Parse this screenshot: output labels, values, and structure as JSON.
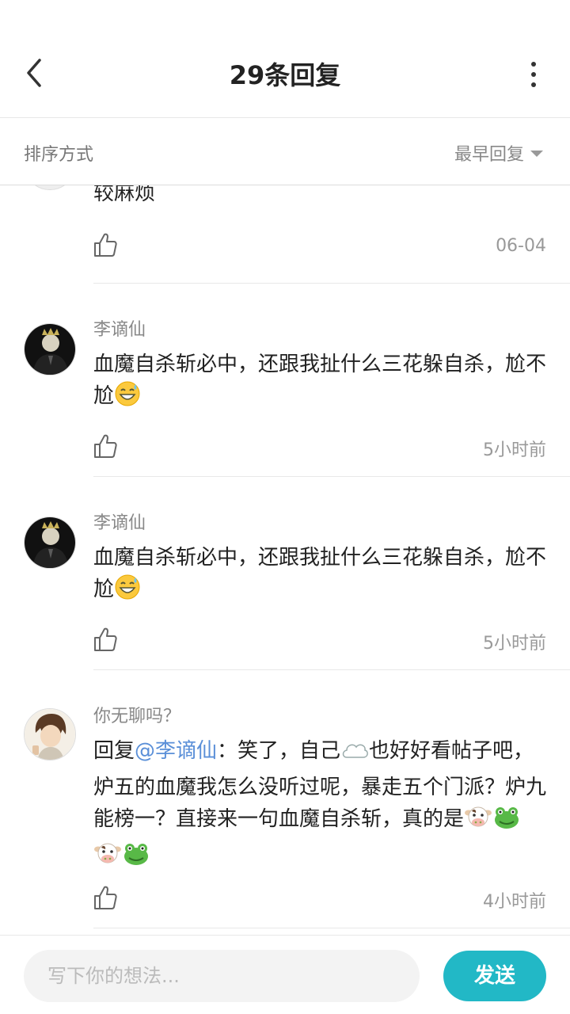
{
  "header": {
    "title": "29条回复"
  },
  "sortbar": {
    "label": "排序方式",
    "selected": "最早回复"
  },
  "comments": [
    {
      "text": "较麻烦",
      "time": "06-04"
    },
    {
      "username": "李谪仙",
      "text": "血魔自杀斩必中，还跟我扯什么三花躲自杀，尬不尬",
      "time": "5小时前"
    },
    {
      "username": "李谪仙",
      "text": "血魔自杀斩必中，还跟我扯什么三花躲自杀，尬不尬",
      "time": "5小时前"
    },
    {
      "username": "你无聊吗？",
      "reply_prefix": "回复",
      "mention": "@李谪仙",
      "text_a": "：笑了，自己",
      "text_b": "也好好看帖子吧，炉五的血魔我怎么没听过呢，暴走五个门派？炉九能榜一？直接来一句血魔自杀斩，真的是",
      "time": "4小时前"
    }
  ],
  "bottombar": {
    "placeholder": "写下你的想法...",
    "send_label": "发送"
  },
  "colors": {
    "accent": "#22b8c6",
    "mention": "#5a8fd8"
  }
}
